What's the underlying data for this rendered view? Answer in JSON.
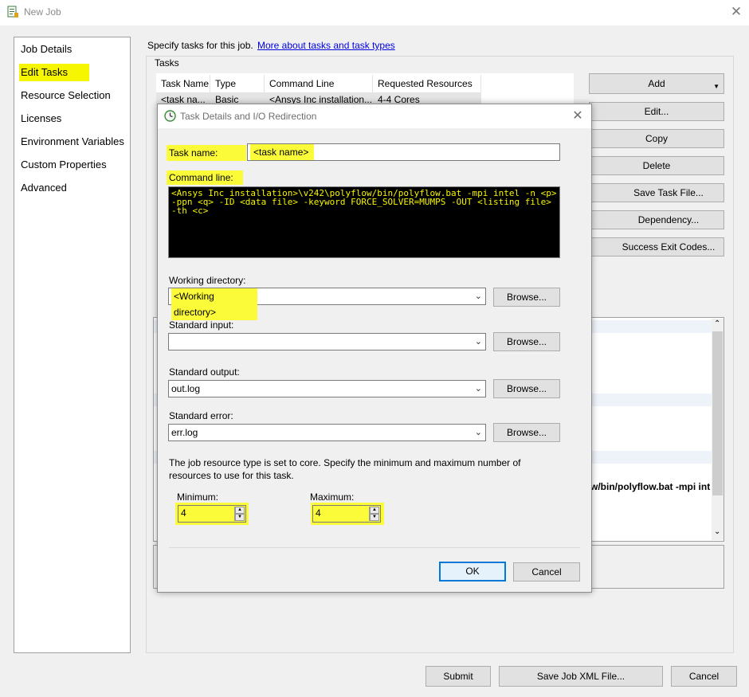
{
  "window": {
    "title": "New Job",
    "close_glyph": "✕"
  },
  "nav": {
    "items": [
      {
        "label": "Job Details"
      },
      {
        "label": "Edit Tasks"
      },
      {
        "label": "Resource Selection"
      },
      {
        "label": "Licenses"
      },
      {
        "label": "Environment Variables"
      },
      {
        "label": "Custom Properties"
      },
      {
        "label": "Advanced"
      }
    ]
  },
  "content": {
    "intro_text": "Specify tasks for this job.",
    "link_text": "More about tasks and task types",
    "tasks_label": "Tasks",
    "tasks_table": {
      "columns": [
        "Task Name",
        "Type",
        "Command Line",
        "Requested Resources"
      ],
      "rows": [
        [
          "<task na...",
          "Basic",
          "<Ansys Inc installation...",
          "4-4 Cores"
        ]
      ]
    },
    "buttons": {
      "add": "Add",
      "edit": "Edit...",
      "copy": "Copy",
      "delete": "Delete",
      "save_task_file": "Save Task File...",
      "dependency": "Dependency...",
      "success_exit_codes": "Success Exit Codes..."
    },
    "cmd_snippet": "w/bin/polyflow.bat -mpi int"
  },
  "footer": {
    "submit": "Submit",
    "save_xml": "Save Job XML File...",
    "cancel": "Cancel"
  },
  "dialog": {
    "title": "Task Details and I/O Redirection",
    "close_glyph": "✕",
    "task_name_label": "Task name:",
    "task_name_value": "<task name>",
    "command_line_label": "Command line:",
    "command_line_value": "<Ansys Inc installation>\\v242\\polyflow/bin/polyflow.bat -mpi intel -n <p> -ppn <q> -ID <data file> -keyword FORCE_SOLVER=MUMPS -OUT <listing file> -th <c>",
    "working_dir_label": "Working directory:",
    "working_dir_value": "<Working directory>",
    "std_input_label": "Standard input:",
    "std_input_value": "",
    "std_output_label": "Standard output:",
    "std_output_value": "out.log",
    "std_error_label": "Standard error:",
    "std_error_value": "err.log",
    "browse_label": "Browse...",
    "resource_note_line1": "The job resource type is set to core. Specify the minimum and maximum number of",
    "resource_note_line2": "resources to use for this task.",
    "minimum_label": "Minimum:",
    "minimum_value": "4",
    "maximum_label": "Maximum:",
    "maximum_value": "4",
    "ok": "OK",
    "cancel": "Cancel"
  },
  "colors": {
    "highlight": "#f6f600",
    "ok_border": "#0078d7",
    "link": "#0000e0"
  }
}
